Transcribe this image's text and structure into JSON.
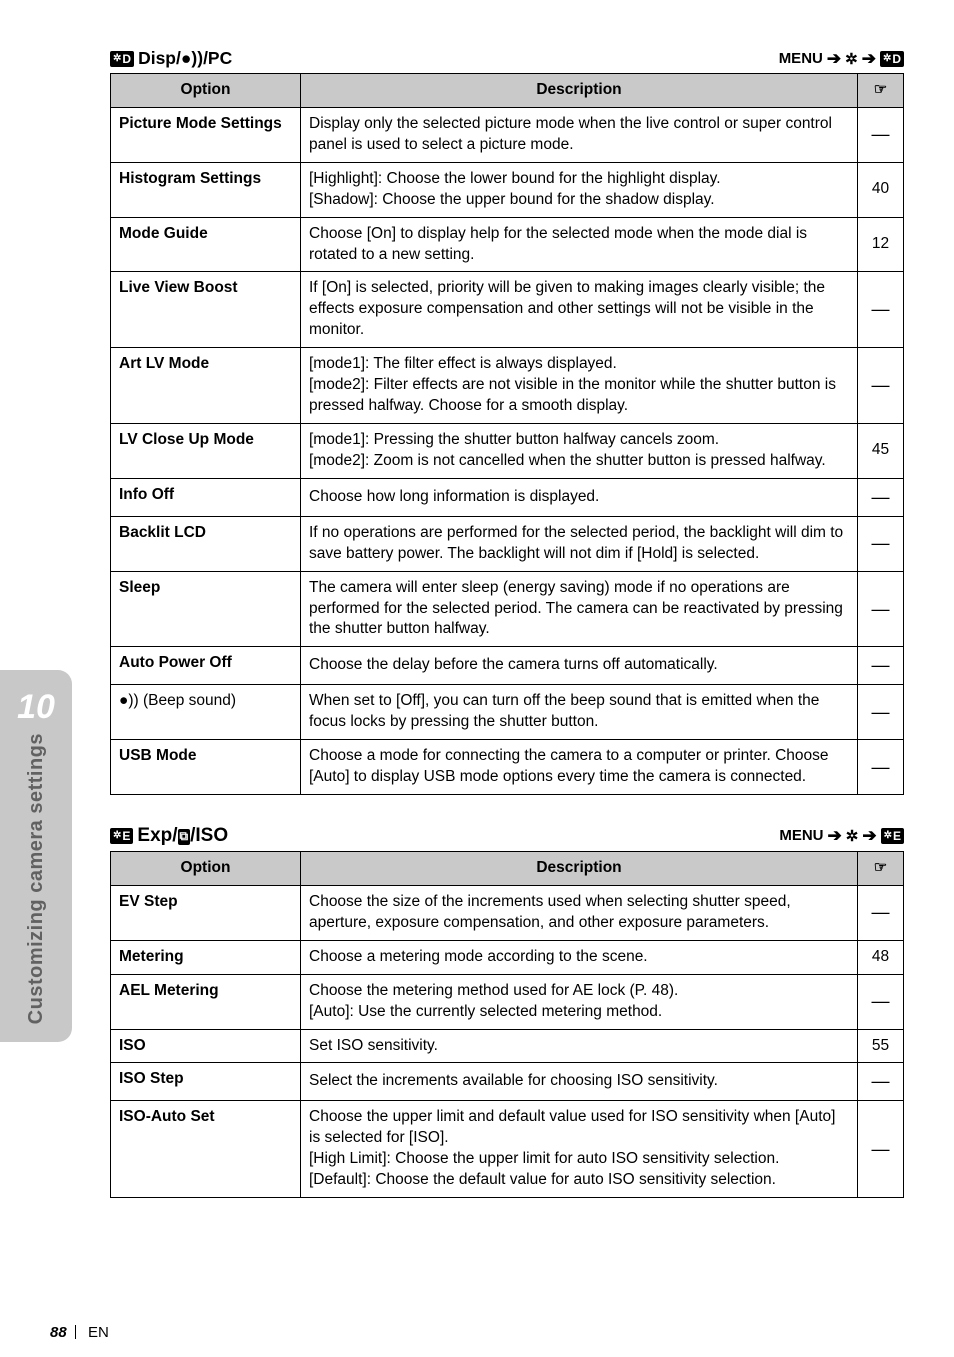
{
  "sidebar": {
    "chapter_number": "10",
    "chapter_title": "Customizing camera settings"
  },
  "footer": {
    "page_number": "88",
    "language": "EN"
  },
  "section_d": {
    "tab_letter": "D",
    "title_text": "Disp/●))/PC",
    "menu_label": "MENU",
    "header_option": "Option",
    "header_desc": "Description",
    "rows": [
      {
        "name": "Picture Mode Settings",
        "desc": "Display only the selected picture mode when the live control or super control panel is used to select a picture mode.",
        "page": "—"
      },
      {
        "name": "Histogram Settings",
        "desc": "[Highlight]: Choose the lower bound for the highlight display.\n[Shadow]: Choose the upper bound for the shadow display.",
        "page": "40"
      },
      {
        "name": "Mode Guide",
        "desc": "Choose [On] to display help for the selected mode when the mode dial is rotated to a new setting.",
        "page": "12"
      },
      {
        "name": "Live View Boost",
        "desc": "If [On] is selected, priority will be given to making images clearly visible; the effects exposure compensation and other settings will not be visible in the monitor.",
        "page": "—"
      },
      {
        "name": "Art LV Mode",
        "desc": "[mode1]: The filter effect is always displayed.\n[mode2]: Filter effects are not visible in the monitor while the shutter button is pressed halfway. Choose for a smooth display.",
        "page": "—"
      },
      {
        "name": "LV Close Up Mode",
        "desc": "[mode1]: Pressing the shutter button halfway cancels zoom.\n[mode2]: Zoom is not cancelled when the shutter button is pressed halfway.",
        "page": "45"
      },
      {
        "name": "Info Off",
        "desc": "Choose how long information is displayed.",
        "page": "—"
      },
      {
        "name": "Backlit LCD",
        "desc": "If no operations are performed for the selected period, the backlight will dim to save battery power. The backlight will not dim if [Hold] is selected.",
        "page": "—"
      },
      {
        "name": "Sleep",
        "desc": "The camera will enter sleep (energy saving) mode if no operations are performed for the selected period. The camera can be reactivated by pressing the shutter button halfway.",
        "page": "—"
      },
      {
        "name": "Auto Power Off",
        "desc": "Choose the delay before the camera turns off automatically.",
        "page": "—"
      },
      {
        "name": "●)) (Beep sound)",
        "desc": "When set to [Off], you can turn off the beep sound that is emitted when the focus locks by pressing the shutter button.",
        "page": "—"
      },
      {
        "name": "USB Mode",
        "desc": "Choose a mode for connecting the camera to a computer or printer. Choose [Auto] to display USB mode options every time the camera is connected.",
        "page": "—"
      }
    ]
  },
  "section_e": {
    "tab_letter": "E",
    "title_pre": "Exp/",
    "title_post": "/ISO",
    "menu_label": "MENU",
    "header_option": "Option",
    "header_desc": "Description",
    "rows": [
      {
        "name": "EV Step",
        "desc": "Choose the size of the increments used when selecting shutter speed, aperture, exposure compensation, and other exposure parameters.",
        "page": "—"
      },
      {
        "name": "Metering",
        "desc": "Choose a metering mode according to the scene.",
        "page": "48"
      },
      {
        "name": "AEL Metering",
        "desc": "Choose the metering method used for AE lock (P. 48).\n[Auto]: Use the currently selected metering method.",
        "page": "—"
      },
      {
        "name": "ISO",
        "desc": "Set ISO sensitivity.",
        "page": "55"
      },
      {
        "name": "ISO Step",
        "desc": "Select the increments available for choosing ISO sensitivity.",
        "page": "—"
      },
      {
        "name": "ISO-Auto Set",
        "desc": "Choose the upper limit and default value used for ISO sensitivity when [Auto] is selected for [ISO].\n[High Limit]: Choose the upper limit for auto ISO sensitivity selection.\n[Default]: Choose the default value for auto ISO sensitivity selection.",
        "page": "—"
      }
    ]
  }
}
